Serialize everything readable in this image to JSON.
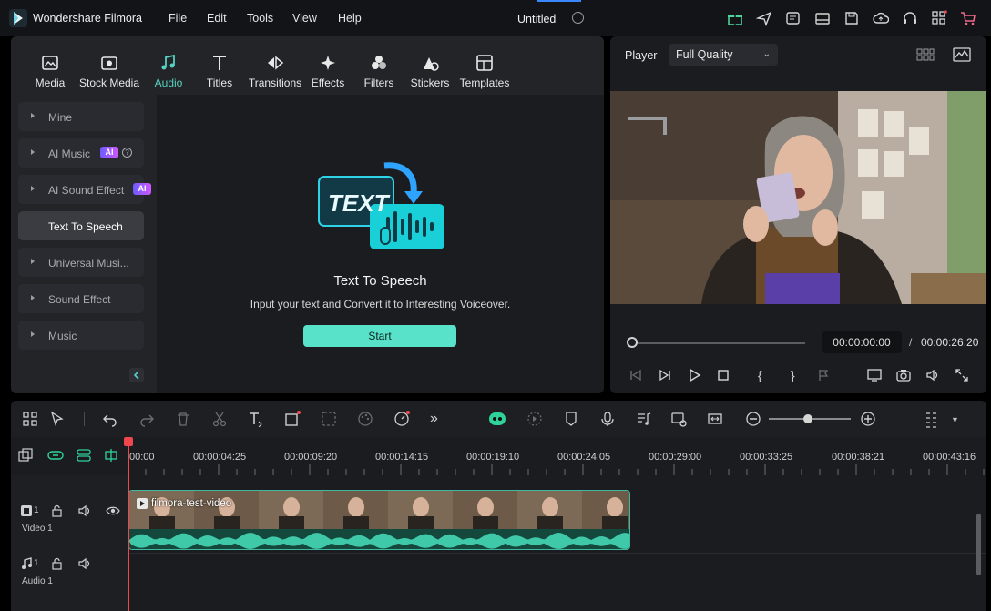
{
  "app": {
    "name": "Wondershare Filmora",
    "menu": [
      "File",
      "Edit",
      "Tools",
      "View",
      "Help"
    ],
    "project_title": "Untitled"
  },
  "library": {
    "tabs": [
      {
        "label": "Media",
        "icon": "media-icon"
      },
      {
        "label": "Stock Media",
        "icon": "stock-media-icon"
      },
      {
        "label": "Audio",
        "icon": "music-note-icon",
        "active": true
      },
      {
        "label": "Titles",
        "icon": "titles-icon"
      },
      {
        "label": "Transitions",
        "icon": "transitions-icon"
      },
      {
        "label": "Effects",
        "icon": "effects-icon"
      },
      {
        "label": "Filters",
        "icon": "filters-icon"
      },
      {
        "label": "Stickers",
        "icon": "stickers-icon"
      },
      {
        "label": "Templates",
        "icon": "templates-icon"
      }
    ],
    "sidebar": [
      {
        "label": "Mine"
      },
      {
        "label": "AI Music",
        "badge": "AI"
      },
      {
        "label": "AI Sound Effect",
        "badge": "AI"
      },
      {
        "label": "Text To Speech",
        "selected": true
      },
      {
        "label": "Universal Musi..."
      },
      {
        "label": "Sound Effect"
      },
      {
        "label": "Music"
      }
    ],
    "tts": {
      "art_text": "TEXT",
      "title": "Text To Speech",
      "description": "Input your text and Convert it to Interesting Voiceover.",
      "start_label": "Start"
    }
  },
  "player": {
    "label": "Player",
    "quality": "Full Quality",
    "current_time": "00:00:00:00",
    "separator": "/",
    "total_time": "00:00:26:20"
  },
  "timeline": {
    "ruler": [
      "00:00",
      "00:00:04:25",
      "00:00:09:20",
      "00:00:14:15",
      "00:00:19:10",
      "00:00:24:05",
      "00:00:29:00",
      "00:00:33:25",
      "00:00:38:21",
      "00:00:43:16"
    ],
    "tracks": [
      {
        "name": "Video 1",
        "index": "1"
      },
      {
        "name": "Audio 1",
        "index": "1"
      }
    ],
    "clip_name": "filmora-test-video"
  },
  "colors": {
    "accent": "#56d1c1",
    "start_button": "#57e2c9",
    "playhead": "#f0474f"
  }
}
